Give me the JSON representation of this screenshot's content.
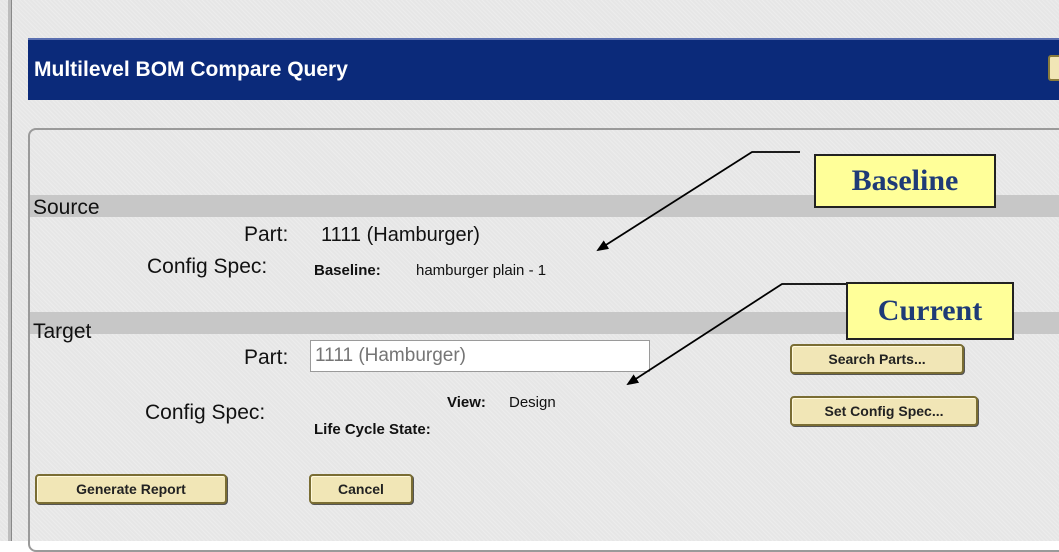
{
  "window": {
    "title": "Multilevel BOM Compare Query",
    "help_label": "?"
  },
  "source": {
    "section_label": "Source",
    "part_label": "Part:",
    "part_value": "1111 (Hamburger)",
    "config_label": "Config Spec:",
    "baseline_label": "Baseline:",
    "baseline_value": "hamburger plain - 1"
  },
  "target": {
    "section_label": "Target",
    "part_label": "Part:",
    "part_placeholder": "1111 (Hamburger)",
    "config_label": "Config Spec:",
    "view_label": "View:",
    "view_value": "Design",
    "lifecycle_label": "Life Cycle State:"
  },
  "buttons": {
    "search_parts": "Search Parts...",
    "set_config_spec": "Set Config Spec...",
    "generate_report": "Generate Report",
    "cancel": "Cancel"
  },
  "callouts": {
    "baseline": "Baseline",
    "current": "Current"
  },
  "colors": {
    "titlebar": "#0b2a7a",
    "button_face": "#f1e6b6",
    "callout_fill": "#ffff99",
    "callout_text": "#1f3b77",
    "section_band": "#c7c7c7"
  }
}
